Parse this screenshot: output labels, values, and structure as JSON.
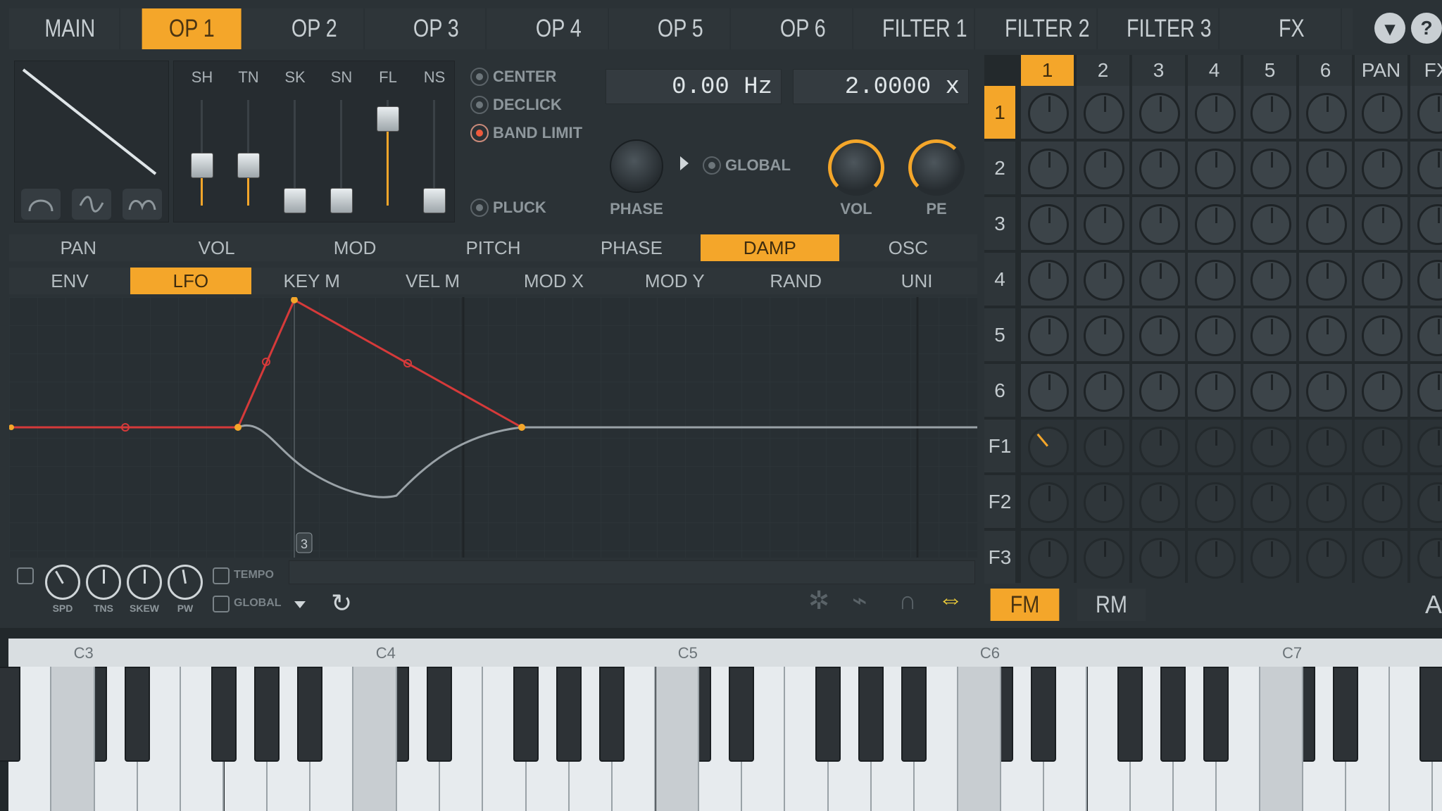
{
  "top_tabs": [
    {
      "label": "MAIN"
    },
    {
      "label": "OP 1",
      "active": true
    },
    {
      "label": "OP 2"
    },
    {
      "label": "OP 3"
    },
    {
      "label": "OP 4"
    },
    {
      "label": "OP 5"
    },
    {
      "label": "OP 6"
    },
    {
      "label": "FILTER 1",
      "mark": true
    },
    {
      "label": "FILTER 2"
    },
    {
      "label": "FILTER 3"
    },
    {
      "label": "FX"
    }
  ],
  "window_buttons": [
    "menu-icon",
    "help-icon"
  ],
  "shaper": {
    "slider_labels": [
      "SH",
      "TN",
      "SK",
      "SN",
      "FL",
      "NS"
    ],
    "slider_levels": [
      0.38,
      0.38,
      0.05,
      0.05,
      0.82,
      0.05
    ]
  },
  "options": {
    "center": "CENTER",
    "declick": "DECLICK",
    "band_limit": "BAND LIMIT",
    "pluck": "PLUCK",
    "global": "GLOBAL"
  },
  "values": {
    "frequency": "0.00 Hz",
    "ratio": "2.0000 x"
  },
  "knobs": {
    "phase": "PHASE",
    "vol": "VOL",
    "pe": "PE"
  },
  "section_tabs": [
    {
      "label": "PAN"
    },
    {
      "label": "VOL",
      "mark": true
    },
    {
      "label": "MOD",
      "mark": true
    },
    {
      "label": "PITCH",
      "mark": true
    },
    {
      "label": "PHASE",
      "mark": true
    },
    {
      "label": "DAMP",
      "active": true
    },
    {
      "label": "OSC"
    }
  ],
  "env_tabs": [
    {
      "label": "ENV"
    },
    {
      "label": "LFO",
      "active": true
    },
    {
      "label": "KEY M",
      "mark": true
    },
    {
      "label": "VEL M"
    },
    {
      "label": "MOD X"
    },
    {
      "label": "MOD Y"
    },
    {
      "label": "RAND"
    },
    {
      "label": "UNI"
    }
  ],
  "envelope": {
    "marker": "3"
  },
  "lfo_knobs": [
    "SPD",
    "TNS",
    "SKEW",
    "PW"
  ],
  "lfo_checks": {
    "tempo": "TEMPO",
    "global": "GLOBAL"
  },
  "matrix": {
    "columns": [
      "1",
      "2",
      "3",
      "4",
      "5",
      "6",
      "PAN",
      "FX"
    ],
    "rows": [
      "1",
      "2",
      "3",
      "4",
      "5",
      "6",
      "F1",
      "F2",
      "F3"
    ],
    "active_column": "1",
    "active_row": "1"
  },
  "modes": {
    "fm": "FM",
    "rm": "RM",
    "extra": "A"
  },
  "keyboard": {
    "octave_labels": [
      "C3",
      "C4",
      "C5",
      "C6",
      "C7"
    ]
  }
}
